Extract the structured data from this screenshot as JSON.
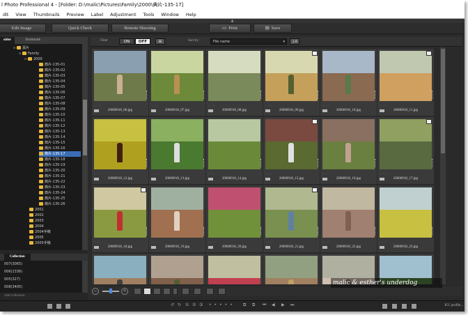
{
  "window": {
    "title": "l Photo Professional 4 - [Folder: D:\\malic\\Pictures\\Family\\2000\\典片-135-17]"
  },
  "menu": [
    "dit",
    "View",
    "Thumbnails",
    "Preview",
    "Label",
    "Adjustment",
    "Tools",
    "Window",
    "Help"
  ],
  "toolbar": {
    "edit_image": "Edit Image",
    "quick_check": "Quick Check",
    "remote_shooting": "Remote Shooting",
    "print": "Print",
    "save": "Save"
  },
  "left_tabs": {
    "folder": "older",
    "bookmark": "Bookmark"
  },
  "tree": {
    "root": "冨片",
    "family": "Family",
    "year": "2000",
    "folders": [
      "典片-135-01",
      "典片-135-02",
      "典片-135-03",
      "典片-135-04",
      "典片-135-05",
      "典片-135-06",
      "典片-135-07",
      "典片-135-08",
      "典片-135-09",
      "典片-135-10",
      "典片-135-11",
      "典片-135-12",
      "典片-135-13",
      "典片-135-14",
      "典片-135-15",
      "典片-135-16",
      "典片-135-17",
      "典片-135-18",
      "典片-135-19",
      "典片-135-20",
      "典片-135-21",
      "典片-135-22",
      "典片-135-23",
      "典片-135-24",
      "典片-135-25",
      "典片-135-26"
    ],
    "selected": "典片-135-17",
    "years": [
      "2001",
      "2002",
      "2003",
      "2004",
      "2004手機",
      "2005",
      "2005手機"
    ]
  },
  "collection": {
    "tab": "Collection",
    "items": [
      "007(3065)",
      "006(1336)",
      "005(327)",
      "008(3405)"
    ],
    "add": "Add collection"
  },
  "filter": {
    "label": "Filter",
    "on": "ON",
    "off": "OFF",
    "sort_label": "Sort by:",
    "sort_value": "File name"
  },
  "thumbnails": [
    "20000918_06.jpg",
    "20000918_07.jpg",
    "20000918_08.jpg",
    "20000918_09.jpg",
    "20000918_10.jpg",
    "20000918_11.jpg",
    "20000918_12.jpg",
    "20000918_13.jpg",
    "20000918_14.jpg",
    "20000918_15.jpg",
    "20000918_16.jpg",
    "20000918_17.jpg",
    "20000918_18.jpg",
    "20000918_19.jpg",
    "20000918_20.jpg",
    "20000918_21.jpg",
    "20000918_22.jpg",
    "20000918_23.jpg",
    "",
    "",
    "",
    "",
    "",
    ""
  ],
  "watermark": "malic & esther's underdog",
  "status": {
    "icc": "ICC profile..."
  },
  "colors": {
    "selected": "#3a6db5",
    "folder": "#e8b83a",
    "background": "#2b2b2b"
  }
}
